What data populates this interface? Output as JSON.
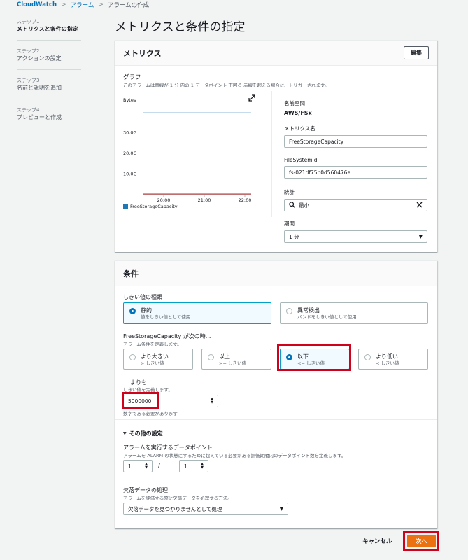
{
  "breadcrumb": {
    "root": "CloudWatch",
    "sep": ">",
    "item1": "アラーム",
    "item2": "アラームの作成"
  },
  "steps": [
    {
      "label": "ステップ1",
      "name": "メトリクスと条件の指定"
    },
    {
      "label": "ステップ2",
      "name": "アクションの設定"
    },
    {
      "label": "ステップ3",
      "name": "名前と説明を追加"
    },
    {
      "label": "ステップ4",
      "name": "プレビューと作成"
    }
  ],
  "page_title": "メトリクスと条件の指定",
  "metrics": {
    "title": "メトリクス",
    "edit_label": "編集",
    "graph_title": "グラフ",
    "graph_desc": "このアラームは青線が 1 分 内の 1 データポイント 下回る 赤線を超える場合に、トリガーされます。",
    "namespace_label": "名前空間",
    "namespace_value": "AWS/FSx",
    "metric_name_label": "メトリクス名",
    "metric_name_value": "FreeStorageCapacity",
    "fs_label": "FileSystemId",
    "fs_value": "fs-021df75b0d560476e",
    "stat_label": "統計",
    "stat_value": "最小",
    "period_label": "期間",
    "period_value": "1 分"
  },
  "chart_data": {
    "type": "line",
    "ylabel": "Bytes",
    "y_ticks": [
      "30.0G",
      "20.0G",
      "10.0G"
    ],
    "y_tick_values": [
      30,
      20,
      10
    ],
    "x_ticks": [
      "20:00",
      "21:00",
      "22:00"
    ],
    "ylim": [
      0,
      44
    ],
    "series": [
      {
        "name": "FreeStorageCapacity",
        "color": "#1f77b4",
        "values": [
          39.5,
          39.5
        ]
      }
    ],
    "threshold": {
      "color": "#d62728",
      "value": 0.005
    },
    "legend": "bottom-left"
  },
  "conditions": {
    "title": "条件",
    "threshold_type_label": "しきい値の種類",
    "static_name": "静的",
    "static_desc": "値をしきい値として使用",
    "anomaly_name": "異常検出",
    "anomaly_desc": "バンドをしきい値として使用",
    "when_label": "FreeStorageCapacity が次の時...",
    "when_desc": "アラーム条件を定義します。",
    "ops": [
      {
        "name": "より大きい",
        "desc": "> しきい値"
      },
      {
        "name": "以上",
        "desc": ">= しきい値"
      },
      {
        "name": "以下",
        "desc": "<= しきい値"
      },
      {
        "name": "より低い",
        "desc": "< しきい値"
      }
    ],
    "than_label": "... よりも",
    "than_desc": "しきい値を定義します。",
    "threshold_value": "5000000",
    "threshold_hint": "数字である必要があります",
    "other_label": "その他の設定",
    "datapoints_label": "アラームを実行するデータポイント",
    "datapoints_desc": "アラームを ALARM の状態にするために超えている必要がある評価期間内のデータポイント数を定義します。",
    "datapoints_a": "1",
    "datapoints_slash": "/",
    "datapoints_b": "1",
    "missing_label": "欠落データの処理",
    "missing_desc": "アラームを評価する際に欠落データを処理する方法。",
    "missing_value": "欠落データを見つかりませんとして処理"
  },
  "footer": {
    "cancel": "キャンセル",
    "next": "次へ"
  }
}
